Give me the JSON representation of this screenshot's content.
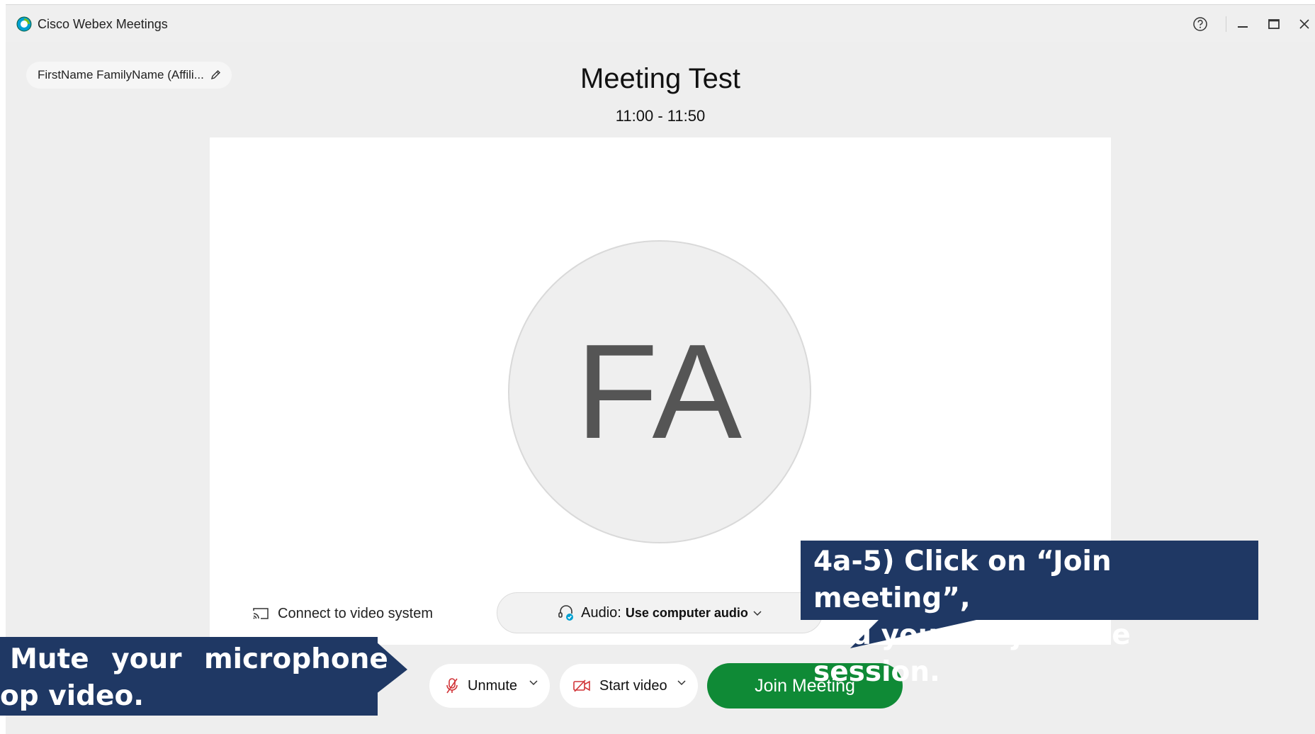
{
  "window": {
    "title": "Cisco Webex Meetings",
    "controls": {
      "help": "help-icon",
      "minimize": "minimize-icon",
      "maximize": "maximize-icon",
      "close": "close-icon"
    }
  },
  "user": {
    "display_name": "FirstName FamilyName (Affili...",
    "initials": "FA"
  },
  "meeting": {
    "title": "Meeting Test",
    "time": "11:00 - 11:50"
  },
  "preview": {
    "connect_video_label": "Connect to video system",
    "audio_label": "Audio:",
    "audio_value": "Use computer audio"
  },
  "controls": {
    "unmute_label": "Unmute",
    "start_video_label": "Start video",
    "join_label": "Join Meeting"
  },
  "annotations": {
    "left_line1": "Mute your microphone",
    "left_line2": "op video.",
    "right_line1": "4a-5) Click on “Join meeting”,",
    "right_line2": "and you can join the session."
  },
  "colors": {
    "join_green": "#0f8a36",
    "callout_navy": "#1f3864",
    "muted_red": "#d13438",
    "webex_blue": "#00a0d1"
  }
}
